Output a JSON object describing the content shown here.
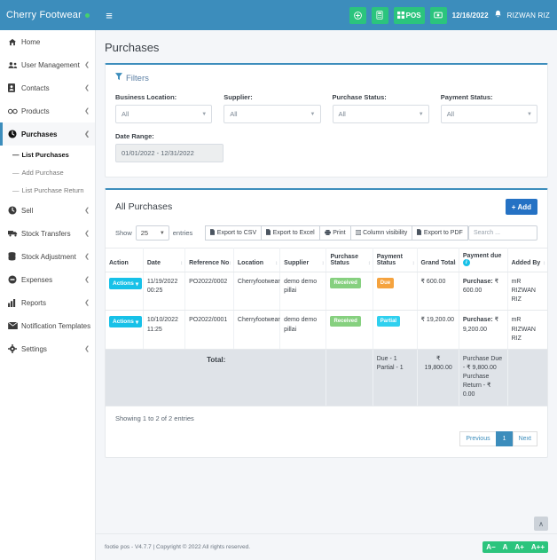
{
  "brand": {
    "name": "Cherry Footwear"
  },
  "topbar": {
    "hamburger": "≡",
    "buttons": [
      {
        "name": "add-button",
        "icon": "plus-circle-icon",
        "label": ""
      },
      {
        "name": "calculator-button",
        "icon": "calculator-icon",
        "label": ""
      },
      {
        "name": "pos-button",
        "icon": "grid-icon",
        "label": "POS"
      },
      {
        "name": "cash-register-button",
        "icon": "cash-icon",
        "label": ""
      }
    ],
    "date": "12/16/2022",
    "username": "RIZWAN RIZ"
  },
  "sidebar": {
    "items": [
      {
        "label": "Home",
        "icon": "home-icon",
        "caret": false,
        "active": false
      },
      {
        "label": "User Management",
        "icon": "users-icon",
        "caret": true,
        "active": false
      },
      {
        "label": "Contacts",
        "icon": "contacts-icon",
        "caret": true,
        "active": false
      },
      {
        "label": "Products",
        "icon": "products-icon",
        "caret": true,
        "active": false
      },
      {
        "label": "Purchases",
        "icon": "purchases-icon",
        "caret": true,
        "active": true
      },
      {
        "label": "Sell",
        "icon": "sell-icon",
        "caret": true,
        "active": false
      },
      {
        "label": "Stock Transfers",
        "icon": "truck-icon",
        "caret": true,
        "active": false
      },
      {
        "label": "Stock Adjustment",
        "icon": "database-icon",
        "caret": true,
        "active": false
      },
      {
        "label": "Expenses",
        "icon": "expenses-icon",
        "caret": true,
        "active": false
      },
      {
        "label": "Reports",
        "icon": "chart-icon",
        "caret": true,
        "active": false
      },
      {
        "label": "Notification Templates",
        "icon": "envelope-icon",
        "caret": false,
        "active": false
      },
      {
        "label": "Settings",
        "icon": "gear-icon",
        "caret": true,
        "active": false
      }
    ],
    "purchases_sub": [
      {
        "label": "List Purchases",
        "current": true
      },
      {
        "label": "Add Purchase",
        "current": false
      },
      {
        "label": "List Purchase Return",
        "current": false
      }
    ]
  },
  "page": {
    "title": "Purchases"
  },
  "filters": {
    "heading": "Filters",
    "fields": [
      {
        "label": "Business Location:",
        "value": "All"
      },
      {
        "label": "Supplier:",
        "value": "All"
      },
      {
        "label": "Purchase Status:",
        "value": "All"
      },
      {
        "label": "Payment Status:",
        "value": "All"
      }
    ],
    "date_range": {
      "label": "Date Range:",
      "value": "01/01/2022 - 12/31/2022"
    }
  },
  "table_card": {
    "title": "All Purchases",
    "add_label": "Add",
    "show_label": "Show",
    "show_value": "25",
    "entries_label": "entries",
    "exports": [
      {
        "label": "Export to CSV",
        "icon": "file-csv-icon"
      },
      {
        "label": "Export to Excel",
        "icon": "file-excel-icon"
      },
      {
        "label": "Print",
        "icon": "printer-icon"
      },
      {
        "label": "Column visibility",
        "icon": "columns-icon"
      },
      {
        "label": "Export to PDF",
        "icon": "file-pdf-icon"
      }
    ],
    "search_placeholder": "Search ...",
    "columns": [
      {
        "label": "Action",
        "sortable": false
      },
      {
        "label": "Date",
        "sortable": true
      },
      {
        "label": "Reference No",
        "sortable": true
      },
      {
        "label": "Location",
        "sortable": true
      },
      {
        "label": "Supplier",
        "sortable": true
      },
      {
        "label": "Purchase Status",
        "sortable": true
      },
      {
        "label": "Payment Status",
        "sortable": true
      },
      {
        "label": "Grand Total",
        "sortable": true
      },
      {
        "label": "Payment due",
        "sortable": false,
        "info": true
      },
      {
        "label": "Added By",
        "sortable": true
      }
    ],
    "rows": [
      {
        "action": "Actions",
        "date": "11/19/2022 00:25",
        "reference_no": "PO2022/0002",
        "location": "Cherryfootwear",
        "supplier": "demo demo pillai",
        "purchase_status": "Received",
        "payment_status": "Due",
        "grand_total": "₹ 600.00",
        "payment_due_label": "Purchase:",
        "payment_due_value": "₹ 600.00",
        "added_by": "mR RIZWAN RIZ"
      },
      {
        "action": "Actions",
        "date": "10/10/2022 11:25",
        "reference_no": "PO2022/0001",
        "location": "Cherryfootwear",
        "supplier": "demo demo pillai",
        "purchase_status": "Received",
        "payment_status": "Partial",
        "grand_total": "₹ 19,200.00",
        "payment_due_label": "Purchase:",
        "payment_due_value": "₹ 9,200.00",
        "added_by": "mR RIZWAN RIZ"
      }
    ],
    "totals": {
      "label": "Total:",
      "payment_status_due": "Due - 1",
      "payment_status_partial": "Partial - 1",
      "grand_total_symbol": "₹",
      "grand_total": "19,800.00",
      "purchase_due": "Purchase Due - ₹ 9,800.00",
      "purchase_return": "Purchase Return - ₹ 0.00"
    },
    "showing": "Showing 1 to 2 of 2 entries",
    "pagination": {
      "previous": "Previous",
      "pages": [
        "1"
      ],
      "next": "Next"
    }
  },
  "footer": {
    "text": "footie pos - V4.7.7 | Copyright © 2022 All rights reserved.",
    "a11y": [
      "A−",
      "A",
      "A+",
      "A++"
    ],
    "to_top": "∧"
  },
  "colors": {
    "primary": "#3c8dbc",
    "green": "#2bc47d",
    "blue_add": "#2572c4",
    "cyan": "#17c1e8",
    "badge_received": "#86d07f",
    "badge_due": "#f5a33f",
    "badge_partial": "#2fd0ef"
  }
}
